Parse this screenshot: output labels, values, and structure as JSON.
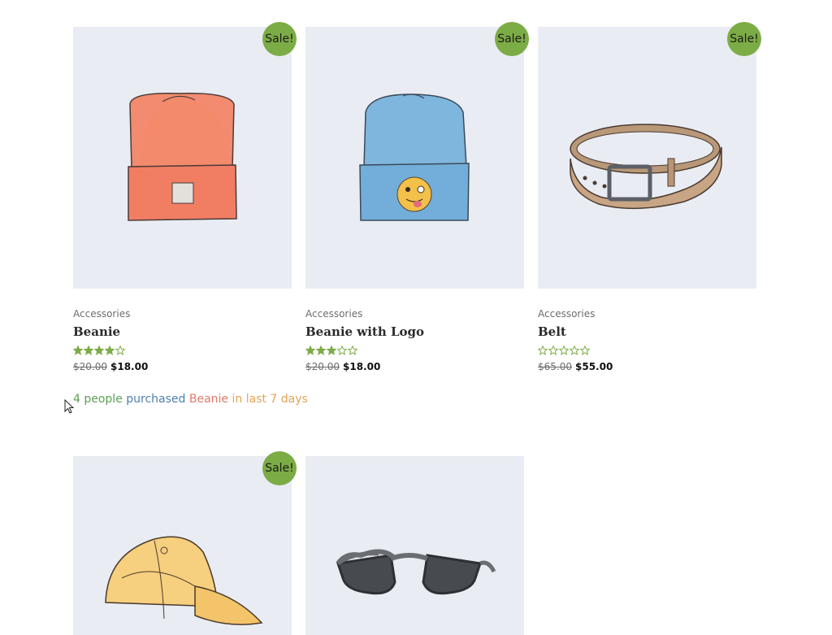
{
  "colors": {
    "sale_badge": "#7cac45",
    "star": "#7cac45",
    "thumb_bg": "#e9ecf3"
  },
  "products": [
    {
      "category": "Accessories",
      "name": "Beanie",
      "sale_badge": "Sale!",
      "rating": 4,
      "regular_price": "$20.00",
      "sale_price": "$18.00",
      "image": "orange-beanie"
    },
    {
      "category": "Accessories",
      "name": "Beanie with Logo",
      "sale_badge": "Sale!",
      "rating": 3,
      "regular_price": "$20.00",
      "sale_price": "$18.00",
      "image": "blue-beanie-emoji"
    },
    {
      "category": "Accessories",
      "name": "Belt",
      "sale_badge": "Sale!",
      "rating": 0,
      "regular_price": "$65.00",
      "sale_price": "$55.00",
      "image": "leather-belt"
    },
    {
      "sale_badge": "Sale!",
      "image": "yellow-cap"
    },
    {
      "image": "sunglasses"
    }
  ],
  "purchase_notice": {
    "count_text": "4 people",
    "verb_text": "purchased",
    "product_text": "Beanie",
    "period_text": "in last 7 days"
  }
}
